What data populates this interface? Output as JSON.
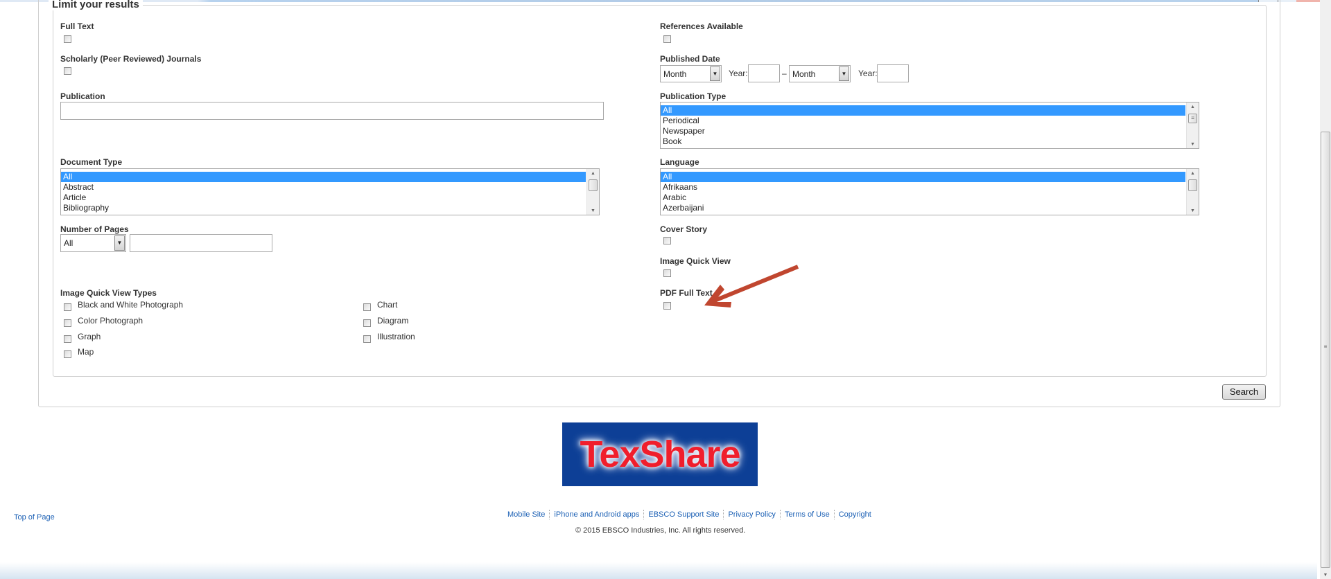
{
  "limiters": {
    "legend": "Limit your results",
    "full_text": {
      "label": "Full Text",
      "checked": false
    },
    "scholarly": {
      "label": "Scholarly (Peer Reviewed) Journals",
      "checked": false
    },
    "publication": {
      "label": "Publication",
      "value": ""
    },
    "document_type": {
      "label": "Document Type",
      "options": [
        "All",
        "Abstract",
        "Article",
        "Bibliography"
      ],
      "selected": "All"
    },
    "number_of_pages": {
      "label": "Number of Pages",
      "select_value": "All",
      "value": ""
    },
    "image_quick_view_types": {
      "label": "Image Quick View Types",
      "col1": [
        "Black and White Photograph",
        "Color Photograph",
        "Graph",
        "Map"
      ],
      "col2": [
        "Chart",
        "Diagram",
        "Illustration"
      ]
    },
    "references_available": {
      "label": "References Available",
      "checked": false
    },
    "published_date": {
      "label": "Published Date",
      "from_month": "Month",
      "year_label": "Year:",
      "from_year": "",
      "separator": "–",
      "to_month": "Month",
      "to_year": ""
    },
    "publication_type": {
      "label": "Publication Type",
      "options": [
        "All",
        "Periodical",
        "Newspaper",
        "Book"
      ],
      "selected": "All"
    },
    "language": {
      "label": "Language",
      "options": [
        "All",
        "Afrikaans",
        "Arabic",
        "Azerbaijani"
      ],
      "selected": "All"
    },
    "cover_story": {
      "label": "Cover Story",
      "checked": false
    },
    "image_quick_view": {
      "label": "Image Quick View",
      "checked": false
    },
    "pdf_full_text": {
      "label": "PDF Full Text",
      "checked": false
    }
  },
  "search_button": "Search",
  "logo_text": "TexShare",
  "annotation": {
    "color": "#c0462f",
    "points_to": "PDF Full Text"
  },
  "footer": {
    "top_of_page": "Top of Page",
    "links": [
      "Mobile Site",
      "iPhone and Android apps",
      "EBSCO Support Site",
      "Privacy Policy",
      "Terms of Use",
      "Copyright"
    ],
    "copyright": "© 2015 EBSCO Industries, Inc. All rights reserved."
  }
}
